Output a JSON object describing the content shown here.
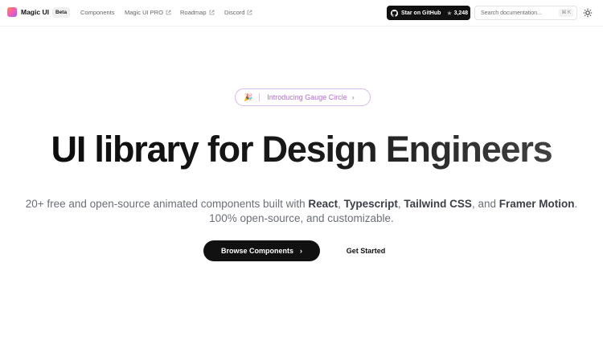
{
  "header": {
    "brand": "Magic UI",
    "badge": "Beta",
    "nav": [
      {
        "label": "Components"
      },
      {
        "label": "Magic UI PRO"
      },
      {
        "label": "Roadmap"
      },
      {
        "label": "Discord"
      }
    ],
    "github": {
      "label": "Star on GitHub",
      "count": "3,248"
    },
    "search": {
      "placeholder": "Search documentation...",
      "shortcut": "⌘ K"
    }
  },
  "hero": {
    "announcement": {
      "emoji": "🎉",
      "label": "Introducing Gauge Circle"
    },
    "headline": "UI library for Design Engineers",
    "subline_1": {
      "prefix": "20+ free and open-source animated components built with ",
      "tech_1": "React",
      "sep_1": ", ",
      "tech_2": "Typescript",
      "sep_2": ", ",
      "tech_3": "Tailwind CSS",
      "sep_3": ", and ",
      "tech_4": "Framer Motion",
      "suffix": "."
    },
    "subline_2": "100% open-source, and customizable.",
    "primary_cta": "Browse Components",
    "secondary_cta": "Get Started"
  },
  "colors": {
    "accent": "#b46cd6",
    "announcement_border": "#d8b9ec",
    "button_dark": "#111111"
  }
}
